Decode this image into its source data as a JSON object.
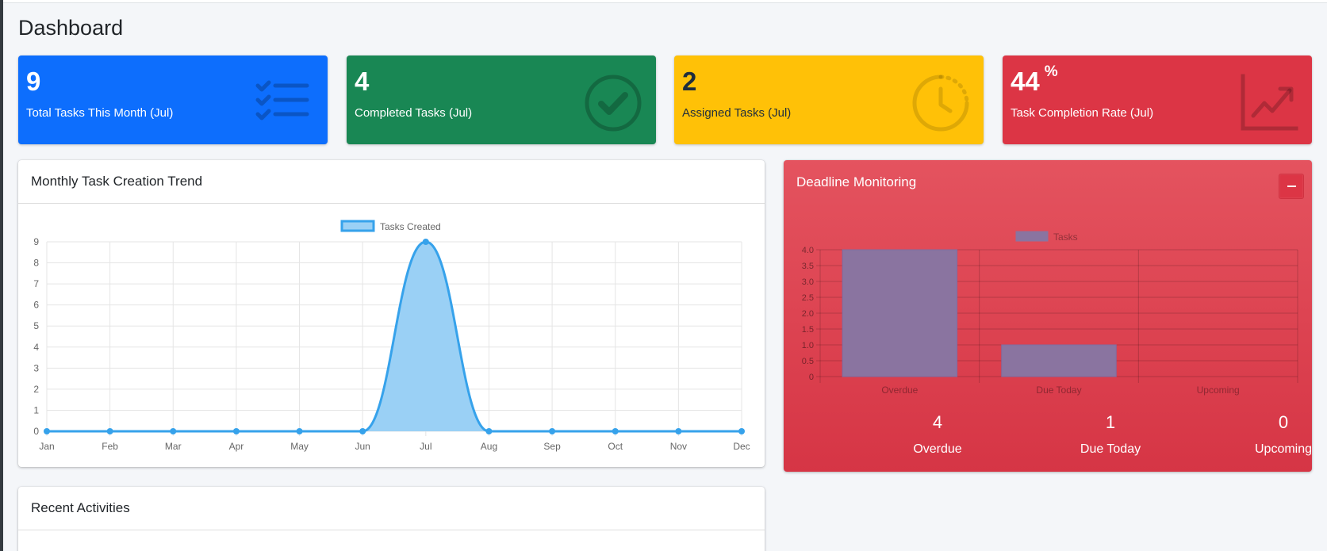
{
  "page": {
    "title": "Dashboard"
  },
  "stats": [
    {
      "value": "9",
      "suffix": "",
      "label": "Total Tasks This Month (Jul)",
      "icon": "tasks-icon",
      "color": "#0d6efd"
    },
    {
      "value": "4",
      "suffix": "",
      "label": "Completed Tasks (Jul)",
      "icon": "check-circle-icon",
      "color": "#198754"
    },
    {
      "value": "2",
      "suffix": "",
      "label": "Assigned Tasks (Jul)",
      "icon": "clock-icon",
      "color": "#ffc107"
    },
    {
      "value": "44",
      "suffix": "%",
      "label": "Task Completion Rate (Jul)",
      "icon": "chart-line-icon",
      "color": "#dc3545"
    }
  ],
  "trend": {
    "title": "Monthly Task Creation Trend",
    "chart_data": {
      "type": "area",
      "categories": [
        "Jan",
        "Feb",
        "Mar",
        "Apr",
        "May",
        "Jun",
        "Jul",
        "Aug",
        "Sep",
        "Oct",
        "Nov",
        "Dec"
      ],
      "series": [
        {
          "name": "Tasks Created",
          "values": [
            0,
            0,
            0,
            0,
            0,
            0,
            9,
            0,
            0,
            0,
            0,
            0
          ]
        }
      ],
      "ylim": [
        0,
        9
      ],
      "yticks": [
        0,
        1,
        2,
        3,
        4,
        5,
        6,
        7,
        8,
        9
      ],
      "legend": "top",
      "grid": true,
      "line_color": "#36a2eb",
      "fill_color": "#9ad0f5"
    }
  },
  "deadline": {
    "title": "Deadline Monitoring",
    "chart_data": {
      "type": "bar",
      "categories": [
        "Overdue",
        "Due Today",
        "Upcoming"
      ],
      "series": [
        {
          "name": "Tasks",
          "values": [
            4,
            1,
            0
          ]
        }
      ],
      "ylim": [
        0,
        4
      ],
      "yticks": [
        "0",
        "0.5",
        "1.0",
        "1.5",
        "2.0",
        "2.5",
        "3.0",
        "3.5",
        "4.0"
      ],
      "legend": "top",
      "grid": true,
      "bar_color": "#8a74a0"
    },
    "summary": [
      {
        "value": "4",
        "label": "Overdue"
      },
      {
        "value": "1",
        "label": "Due Today"
      },
      {
        "value": "0",
        "label": "Upcoming"
      }
    ]
  },
  "activities": {
    "title": "Recent Activities"
  }
}
